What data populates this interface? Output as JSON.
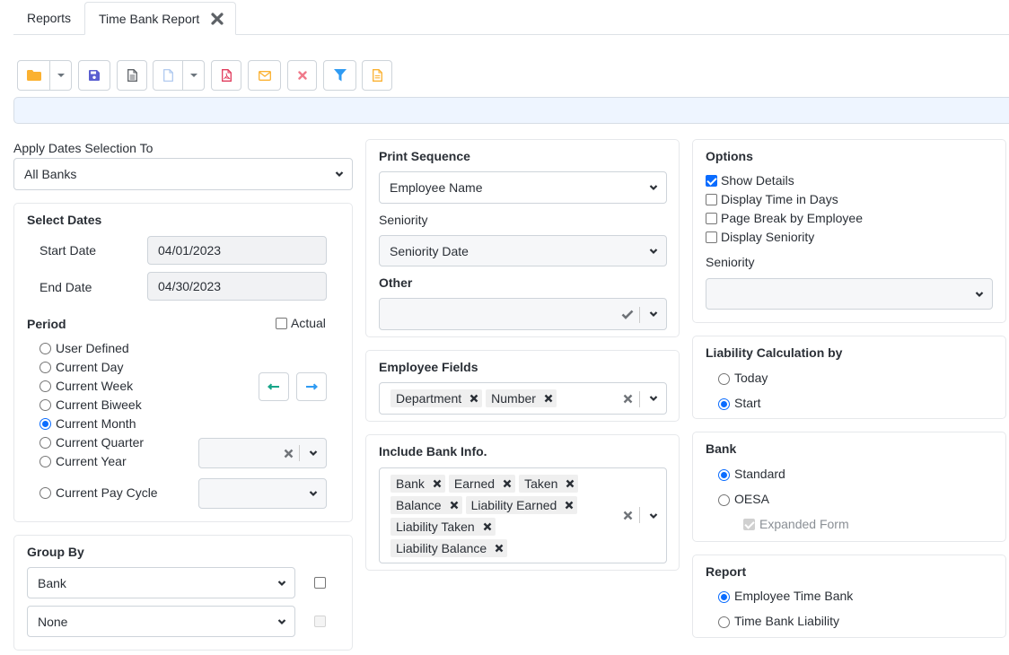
{
  "tabs": [
    {
      "label": "Reports",
      "active": false
    },
    {
      "label": "Time Bank Report",
      "active": true,
      "closable": true
    }
  ],
  "toolbar": {
    "buttons": [
      {
        "name": "open",
        "icon": "folder-icon",
        "has_dropdown": true,
        "color": "#fbb130"
      },
      {
        "name": "save",
        "icon": "floppy-disk-icon",
        "color": "#5a5fd0"
      },
      {
        "name": "preview",
        "icon": "document-icon",
        "color": "#5f6368"
      },
      {
        "name": "new",
        "icon": "blank-file-icon",
        "has_dropdown": true,
        "color": "#a9c5ee"
      },
      {
        "name": "pdf",
        "icon": "pdf-icon",
        "color": "#e03b5c"
      },
      {
        "name": "email",
        "icon": "envelope-icon",
        "color": "#fbb130"
      },
      {
        "name": "delete",
        "icon": "close-icon",
        "color": "#f07a8a"
      },
      {
        "name": "filter",
        "icon": "filter-icon",
        "color": "#2f9bf3"
      },
      {
        "name": "export",
        "icon": "document-lines-icon",
        "color": "#fbb130"
      }
    ]
  },
  "apply_dates": {
    "label": "Apply Dates Selection To",
    "value": "All Banks"
  },
  "select_dates": {
    "title": "Select Dates",
    "start_label": "Start Date",
    "start_value": "04/01/2023",
    "end_label": "End Date",
    "end_value": "04/30/2023",
    "period_label": "Period",
    "actual_label": "Actual",
    "actual_checked": false,
    "periods": [
      {
        "label": "User Defined",
        "selected": false
      },
      {
        "label": "Current Day",
        "selected": false
      },
      {
        "label": "Current Week",
        "selected": false
      },
      {
        "label": "Current Biweek",
        "selected": false
      },
      {
        "label": "Current Month",
        "selected": true
      },
      {
        "label": "Current Quarter",
        "selected": false
      },
      {
        "label": "Current Year",
        "selected": false
      },
      {
        "label": "Current Pay Cycle",
        "selected": false
      }
    ],
    "prev_icon": "arrow-left-icon",
    "next_icon": "arrow-right-icon",
    "quarter_select_value": "",
    "pay_cycle_select_value": ""
  },
  "group_by": {
    "title": "Group By",
    "rows": [
      {
        "value": "Bank",
        "checked": false,
        "checkbox_disabled": false
      },
      {
        "value": "None",
        "checked": false,
        "checkbox_disabled": true
      }
    ]
  },
  "print_sequence": {
    "title": "Print Sequence",
    "value": "Employee Name",
    "seniority_label": "Seniority",
    "seniority_value": "Seniority Date",
    "other_label": "Other",
    "other_value": ""
  },
  "employee_fields": {
    "title": "Employee Fields",
    "chips": [
      "Department",
      "Number"
    ]
  },
  "bank_info": {
    "title": "Include Bank Info.",
    "chip_rows": [
      [
        "Bank",
        "Earned",
        "Taken"
      ],
      [
        "Balance",
        "Liability Earned"
      ],
      [
        "Liability Taken"
      ],
      [
        "Liability Balance"
      ]
    ]
  },
  "options": {
    "title": "Options",
    "items": [
      {
        "label": "Show Details",
        "checked": true
      },
      {
        "label": "Display Time in Days",
        "checked": false
      },
      {
        "label": "Page Break by Employee",
        "checked": false
      },
      {
        "label": "Display Seniority",
        "checked": false
      }
    ],
    "seniority_label": "Seniority",
    "seniority_value": ""
  },
  "liability": {
    "title": "Liability Calculation by",
    "options": [
      {
        "label": "Today",
        "selected": false
      },
      {
        "label": "Start",
        "selected": true
      }
    ]
  },
  "bank": {
    "title": "Bank",
    "options": [
      {
        "label": "Standard",
        "selected": true
      },
      {
        "label": "OESA",
        "selected": false
      }
    ],
    "expanded_form_label": "Expanded Form",
    "expanded_form_checked": true,
    "expanded_form_disabled": true
  },
  "report": {
    "title": "Report",
    "options": [
      {
        "label": "Employee Time Bank",
        "selected": true
      },
      {
        "label": "Time Bank Liability",
        "selected": false
      }
    ]
  }
}
